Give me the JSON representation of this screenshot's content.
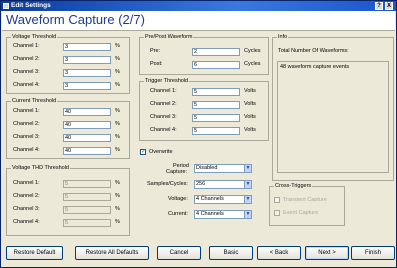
{
  "window": {
    "title": "Edit Settings",
    "heading": "Waveform Capture (2/7)"
  },
  "voltage_threshold": {
    "label": "Voltage Threshold",
    "rows": [
      {
        "label": "Channel 1:",
        "value": "3",
        "unit": "%"
      },
      {
        "label": "Channel 2:",
        "value": "3",
        "unit": "%"
      },
      {
        "label": "Channel 3:",
        "value": "3",
        "unit": "%"
      },
      {
        "label": "Channel 4:",
        "value": "3",
        "unit": "%"
      }
    ]
  },
  "current_threshold": {
    "label": "Current Threshold",
    "rows": [
      {
        "label": "Channel 1:",
        "value": "40",
        "unit": "%"
      },
      {
        "label": "Channel 2:",
        "value": "40",
        "unit": "%"
      },
      {
        "label": "Channel 3:",
        "value": "40",
        "unit": "%"
      },
      {
        "label": "Channel 4:",
        "value": "40",
        "unit": "%"
      }
    ]
  },
  "voltage_thd_threshold": {
    "label": "Voltage THD Threshold",
    "rows": [
      {
        "label": "Channel 1:",
        "value": "5",
        "unit": "%"
      },
      {
        "label": "Channel 2:",
        "value": "5",
        "unit": "%"
      },
      {
        "label": "Channel 3:",
        "value": "5",
        "unit": "%"
      },
      {
        "label": "Channel 4:",
        "value": "5",
        "unit": "%"
      }
    ]
  },
  "pre_post": {
    "label": "Pre/Post Waveform",
    "rows": [
      {
        "label": "Pre:",
        "value": "2",
        "unit": "Cycles"
      },
      {
        "label": "Post:",
        "value": "6",
        "unit": "Cycles"
      }
    ]
  },
  "trigger_threshold": {
    "label": "Trigger Threshold",
    "rows": [
      {
        "label": "Channel 1:",
        "value": "5",
        "unit": "Volts"
      },
      {
        "label": "Channel 2:",
        "value": "5",
        "unit": "Volts"
      },
      {
        "label": "Channel 3:",
        "value": "5",
        "unit": "Volts"
      },
      {
        "label": "Channel 4:",
        "value": "5",
        "unit": "Volts"
      }
    ]
  },
  "overwrite": {
    "label": "Overwrite",
    "checked": "✓"
  },
  "selects": {
    "period_capture": {
      "label1": "Period",
      "label2": "Capture:",
      "value": "Disabled"
    },
    "samples_cycles": {
      "label": "Samples/Cycles:",
      "value": "256"
    },
    "voltage": {
      "label": "Voltage:",
      "value": "4 Channels"
    },
    "current": {
      "label": "Current:",
      "value": "4 Channels"
    }
  },
  "info": {
    "label": "Info",
    "total_label": "Total Number Of Waveforms:",
    "events": "48 waveform capture events"
  },
  "cross_triggers": {
    "label": "Cross-Triggers",
    "transient": "Transient Capture",
    "event": "Event Capture"
  },
  "buttons": {
    "restore_default": "Restore Default",
    "restore_all": "Restore All Defaults",
    "cancel": "Cancel",
    "basic": "Basic",
    "back": "< Back",
    "next": "Next >",
    "finish": "Finish"
  },
  "title_buttons": {
    "help": "?",
    "close": "X"
  }
}
